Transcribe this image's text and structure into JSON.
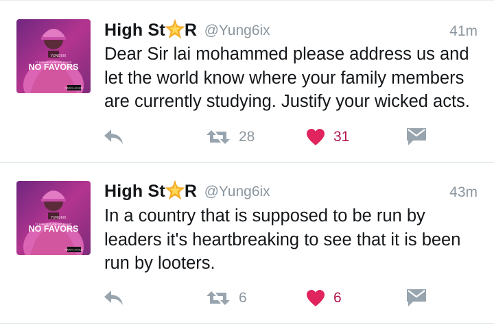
{
  "colors": {
    "text": "#14171a",
    "secondary": "#8a959e",
    "icon": "#98a4ae",
    "like": "#e0245e",
    "like_count": "#b0144f",
    "divider": "#e6ecf0",
    "star": "#f7b52c"
  },
  "tweets": [
    {
      "author_name_before_icon": "High St",
      "author_name_after_icon": "R",
      "name_icon": "star-emoji",
      "handle": "@Yung6ix",
      "time": "41m",
      "text": "Dear Sir lai mohammed please address us and let the world know where your family members are currently studying. Justify your wicked acts.",
      "retweets": "28",
      "likes": "31",
      "avatar": {
        "brand": "YUNG6IX",
        "title": "NO FAVORS",
        "tagline": "FT DIVA GISS AND MR JOLLOF",
        "badge": "PARENTAL ADVISORY"
      }
    },
    {
      "author_name_before_icon": "High St",
      "author_name_after_icon": "R",
      "name_icon": "star-emoji",
      "handle": "@Yung6ix",
      "time": "43m",
      "text": "In a country that is supposed to be run by leaders it's heartbreaking to see that it is been run by looters.",
      "retweets": "6",
      "likes": "6",
      "avatar": {
        "brand": "YUNG6IX",
        "title": "NO FAVORS",
        "tagline": "FT DIVA GISS AND MR JOLLOF",
        "badge": "PARENTAL ADVISORY"
      }
    }
  ]
}
